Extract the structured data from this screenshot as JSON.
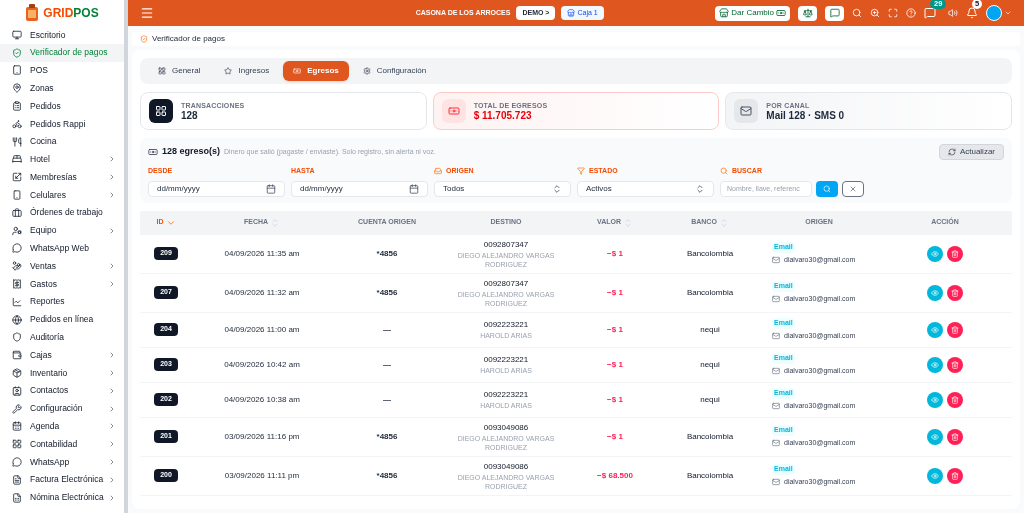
{
  "brand": {
    "name_a": "GRID",
    "name_b": "POS"
  },
  "sidebar": {
    "items": [
      {
        "label": "Escritorio",
        "selected": false,
        "expandable": false
      },
      {
        "label": "Verificador de pagos",
        "selected": true,
        "expandable": false
      },
      {
        "label": "POS",
        "selected": false,
        "expandable": false
      },
      {
        "label": "Zonas",
        "selected": false,
        "expandable": false
      },
      {
        "label": "Pedidos",
        "selected": false,
        "expandable": false
      },
      {
        "label": "Pedidos Rappi",
        "selected": false,
        "expandable": false
      },
      {
        "label": "Cocina",
        "selected": false,
        "expandable": false
      },
      {
        "label": "Hotel",
        "selected": false,
        "expandable": true
      },
      {
        "label": "Membresías",
        "selected": false,
        "expandable": true
      },
      {
        "label": "Celulares",
        "selected": false,
        "expandable": true
      },
      {
        "label": "Órdenes de trabajo",
        "selected": false,
        "expandable": false
      },
      {
        "label": "Equipo",
        "selected": false,
        "expandable": true
      },
      {
        "label": "WhatsApp Web",
        "selected": false,
        "expandable": false
      },
      {
        "label": "Ventas",
        "selected": false,
        "expandable": true
      },
      {
        "label": "Gastos",
        "selected": false,
        "expandable": true
      },
      {
        "label": "Reportes",
        "selected": false,
        "expandable": false
      },
      {
        "label": "Pedidos en línea",
        "selected": false,
        "expandable": false
      },
      {
        "label": "Auditoría",
        "selected": false,
        "expandable": false
      },
      {
        "label": "Cajas",
        "selected": false,
        "expandable": true
      },
      {
        "label": "Inventario",
        "selected": false,
        "expandable": true
      },
      {
        "label": "Contactos",
        "selected": false,
        "expandable": true
      },
      {
        "label": "Configuración",
        "selected": false,
        "expandable": true
      },
      {
        "label": "Agenda",
        "selected": false,
        "expandable": true
      },
      {
        "label": "Contabilidad",
        "selected": false,
        "expandable": true
      },
      {
        "label": "WhatsApp",
        "selected": false,
        "expandable": true
      },
      {
        "label": "Factura Electrónica",
        "selected": false,
        "expandable": true
      },
      {
        "label": "Nómina Electrónica",
        "selected": false,
        "expandable": true
      }
    ]
  },
  "topbar": {
    "business": "CASONA DE LOS ARROCES",
    "mode_button": "DEMO >",
    "register_button": "Caja 1",
    "change_button": "Dar Cambio",
    "chat_count": "29",
    "notification_count": "5"
  },
  "breadcrumb": "Verificador de pagos",
  "tabs": [
    {
      "label": "General",
      "selected": false
    },
    {
      "label": "Ingresos",
      "selected": false
    },
    {
      "label": "Egresos",
      "selected": true
    },
    {
      "label": "Configuración",
      "selected": false
    }
  ],
  "stats": [
    {
      "label": "TRANSACCIONES",
      "value": "128",
      "kind": "neutral"
    },
    {
      "label": "TOTAL DE EGRESOS",
      "value": "$ 11.705.723",
      "kind": "danger"
    },
    {
      "label": "POR CANAL",
      "value": "Mail 128 · SMS 0",
      "kind": "muted"
    }
  ],
  "summary": {
    "count": "128 egreso(s)",
    "note": "Dinero que salió (pagaste / enviaste). Solo registro, sin alerta ni voz."
  },
  "refresh_button": "Actualizar",
  "filters": [
    {
      "kind": "date",
      "label": "DESDE",
      "value": "dd/mm/yyyy"
    },
    {
      "kind": "date",
      "label": "HASTA",
      "value": "dd/mm/yyyy"
    },
    {
      "kind": "select",
      "label": "ORIGEN",
      "value": "Todos"
    },
    {
      "kind": "select",
      "label": "ESTADO",
      "value": "Activos"
    },
    {
      "kind": "search",
      "label": "BUSCAR",
      "placeholder": "Nombre, llave, referenc"
    }
  ],
  "table": {
    "columns": [
      {
        "label": "ID",
        "sortable": true,
        "sorted": true
      },
      {
        "label": "FECHA",
        "sortable": true,
        "sorted": false
      },
      {
        "label": "CUENTA ORIGEN",
        "sortable": false,
        "sorted": false
      },
      {
        "label": "DESTINO",
        "sortable": false,
        "sorted": false
      },
      {
        "label": "VALOR",
        "sortable": true,
        "sorted": false
      },
      {
        "label": "BANCO",
        "sortable": true,
        "sorted": false
      },
      {
        "label": "ORIGEN",
        "sortable": false,
        "sorted": false
      },
      {
        "label": "ACCIÓN",
        "sortable": false,
        "sorted": false
      }
    ],
    "rows": [
      {
        "id": "209",
        "date": "04/09/2026 11:35 am",
        "account": "*4856",
        "dest_number": "0092807347",
        "dest_name": "DIEGO ALEJANDRO VARGAS RODRIGUEZ",
        "amount": "−$ 1",
        "bank": "Bancolombia",
        "channel": "Email",
        "email": "dialvaro30@gmail.com"
      },
      {
        "id": "207",
        "date": "04/09/2026 11:32 am",
        "account": "*4856",
        "dest_number": "0092807347",
        "dest_name": "DIEGO ALEJANDRO VARGAS RODRIGUEZ",
        "amount": "−$ 1",
        "bank": "Bancolombia",
        "channel": "Email",
        "email": "dialvaro30@gmail.com"
      },
      {
        "id": "204",
        "date": "04/09/2026 11:00 am",
        "account": "—",
        "dest_number": "0092223221",
        "dest_name": "HAROLD ARIAS",
        "amount": "−$ 1",
        "bank": "nequi",
        "channel": "Email",
        "email": "dialvaro30@gmail.com"
      },
      {
        "id": "203",
        "date": "04/09/2026 10:42 am",
        "account": "—",
        "dest_number": "0092223221",
        "dest_name": "HAROLD ARIAS",
        "amount": "−$ 1",
        "bank": "nequi",
        "channel": "Email",
        "email": "dialvaro30@gmail.com"
      },
      {
        "id": "202",
        "date": "04/09/2026 10:38 am",
        "account": "—",
        "dest_number": "0092223221",
        "dest_name": "HAROLD ARIAS",
        "amount": "−$ 1",
        "bank": "nequi",
        "channel": "Email",
        "email": "dialvaro30@gmail.com"
      },
      {
        "id": "201",
        "date": "03/09/2026 11:16 pm",
        "account": "*4856",
        "dest_number": "0093049086",
        "dest_name": "DIEGO ALEJANDRO VARGAS RODRIGUEZ",
        "amount": "−$ 1",
        "bank": "Bancolombia",
        "channel": "Email",
        "email": "dialvaro30@gmail.com"
      },
      {
        "id": "200",
        "date": "03/09/2026 11:11 pm",
        "account": "*4856",
        "dest_number": "0093049086",
        "dest_name": "DIEGO ALEJANDRO VARGAS RODRIGUEZ",
        "amount": "−$ 68.500",
        "bank": "Bancolombia",
        "channel": "Email",
        "email": "dialvaro30@gmail.com"
      }
    ]
  }
}
